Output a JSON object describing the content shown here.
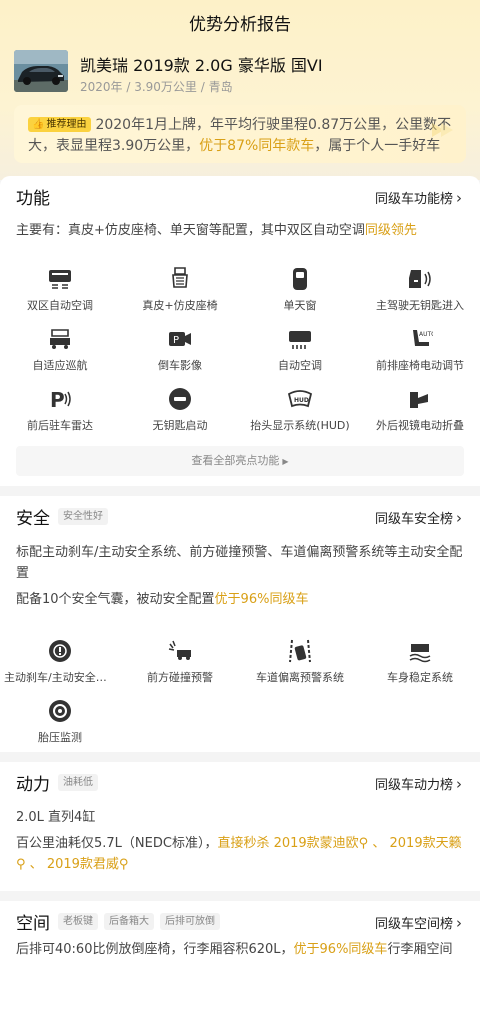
{
  "page_title": "优势分析报告",
  "car": {
    "name": "凯美瑞 2019款 2.0G 豪华版 国VI",
    "meta": "2020年 / 3.90万公里 / 青岛"
  },
  "recommend": {
    "badge": "推荐理由",
    "text_a": "2020年1月上牌，年平均行驶里程0.87万公里，公里数不大，表显里程3.90万公里，",
    "highlight": "优于87%同年款车",
    "text_b": "，属于个人一手好车"
  },
  "function": {
    "title": "功能",
    "link": "同级车功能榜",
    "desc_a": "主要有：真皮+仿皮座椅、单天窗等配置，其中双区自动空调",
    "desc_highlight": "同级领先",
    "features": [
      {
        "label": "双区自动空调",
        "icon": "dual-zone-ac-icon"
      },
      {
        "label": "真皮+仿皮座椅",
        "icon": "leather-seat-icon"
      },
      {
        "label": "单天窗",
        "icon": "sunroof-icon"
      },
      {
        "label": "主驾驶无钥匙进入",
        "icon": "keyless-entry-icon"
      },
      {
        "label": "自适应巡航",
        "icon": "adaptive-cruise-icon"
      },
      {
        "label": "倒车影像",
        "icon": "reverse-camera-icon"
      },
      {
        "label": "自动空调",
        "icon": "auto-ac-icon"
      },
      {
        "label": "前排座椅电动调节",
        "icon": "power-seat-icon"
      },
      {
        "label": "前后驻车雷达",
        "icon": "parking-radar-icon"
      },
      {
        "label": "无钥匙启动",
        "icon": "keyless-start-icon"
      },
      {
        "label": "抬头显示系统(HUD)",
        "icon": "hud-icon"
      },
      {
        "label": "外后视镜电动折叠",
        "icon": "mirror-fold-icon"
      }
    ],
    "see_all": "查看全部亮点功能"
  },
  "safety": {
    "title": "安全",
    "tag": "安全性好",
    "link": "同级车安全榜",
    "desc1": "标配主动刹车/主动安全系统、前方碰撞预警、车道偏离预警系统等主动安全配置",
    "desc2_a": "配备10个安全气囊，被动安全配置",
    "desc2_highlight": "优于96%同级车",
    "features": [
      {
        "label": "主动刹车/主动安全系统",
        "icon": "active-brake-icon"
      },
      {
        "label": "前方碰撞预警",
        "icon": "collision-warning-icon"
      },
      {
        "label": "车道偏离预警系统",
        "icon": "lane-departure-icon"
      },
      {
        "label": "车身稳定系统",
        "icon": "stability-icon"
      },
      {
        "label": "胎压监测",
        "icon": "tire-pressure-icon"
      }
    ]
  },
  "power": {
    "title": "动力",
    "tag": "油耗低",
    "link": "同级车动力榜",
    "engine": "2.0L 直列4缸",
    "desc_a": "百公里油耗仅5.7L（NEDC标准），",
    "desc_highlight": "直接秒杀 2019款蒙迪欧",
    "sep1": "、",
    "compare2": "2019款天籁",
    "sep2": "、",
    "compare3": "2019款君威"
  },
  "space": {
    "title": "空间",
    "tags": [
      "老板键",
      "后备箱大",
      "后排可放倒"
    ],
    "link": "同级车空间榜",
    "desc_a": "后排可40:60比例放倒座椅，行李厢容积620L，",
    "desc_highlight": "优于96%同级车",
    "desc_b": "行李厢空间"
  },
  "colors": {
    "accent": "#d9a017",
    "badge": "#fbd23f",
    "header_bg": "#fdf1c8"
  }
}
